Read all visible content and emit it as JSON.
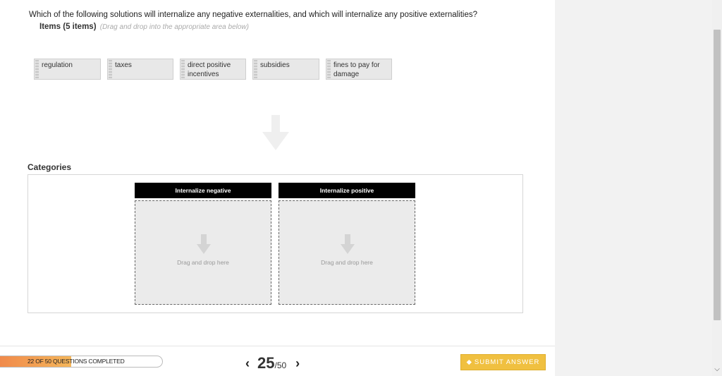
{
  "question": {
    "text": "Which of the following solutions will internalize any negative externalities, and which will internalize any positive externalities?",
    "items_label": "Items (5 items)",
    "items_hint": "(Drag and drop into the appropriate area below)"
  },
  "items": [
    {
      "label": "regulation"
    },
    {
      "label": "taxes"
    },
    {
      "label": "direct positive incentives"
    },
    {
      "label": "subsidies"
    },
    {
      "label": "fines to pay for damage"
    }
  ],
  "categories": {
    "label": "Categories",
    "columns": [
      {
        "title": "Internalize negative",
        "drop_text": "Drag and drop here"
      },
      {
        "title": "Internalize positive",
        "drop_text": "Drag and drop here"
      }
    ]
  },
  "footer": {
    "progress_text": "22 OF 50 QUESTIONS COMPLETED",
    "progress_fraction": 0.44,
    "current_page": "25",
    "total_pages": "/50",
    "submit_label": "SUBMIT ANSWER"
  },
  "colors": {
    "accent": "#f0c040",
    "progress_start": "#f08a4b",
    "category_header": "#000000"
  }
}
